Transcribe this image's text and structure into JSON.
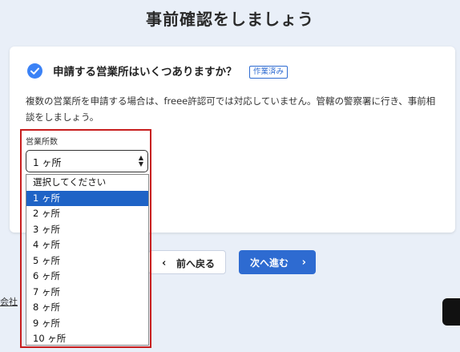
{
  "page": {
    "title": "事前確認をしましょう"
  },
  "card": {
    "question": "申請する営業所はいくつありますか？",
    "badge": "作業済み",
    "description": "複数の営業所を申請する場合は、freee許認可では対応していません。管轄の警察署に行き、事前相談をしましょう。"
  },
  "field": {
    "label": "営業所数",
    "selected_value": "1 ヶ所",
    "options": [
      "選択してください",
      "1 ヶ所",
      "2 ヶ所",
      "3 ヶ所",
      "4 ヶ所",
      "5 ヶ所",
      "6 ヶ所",
      "7 ヶ所",
      "8 ヶ所",
      "9 ヶ所",
      "10 ヶ所"
    ],
    "highlighted_index": 1
  },
  "nav": {
    "back_label": "前へ戻る",
    "next_label": "次へ進む"
  },
  "footer": {
    "link_text": "会社"
  },
  "colors": {
    "accent": "#2e6bd1",
    "highlight_border": "#c71e1e",
    "selected_option": "#1e63c6",
    "background": "#e9eff8"
  },
  "icons": {
    "check": "check-circle-icon",
    "back": "chevron-left-icon",
    "next": "chevron-right-icon",
    "select": "select-arrows-icon"
  }
}
